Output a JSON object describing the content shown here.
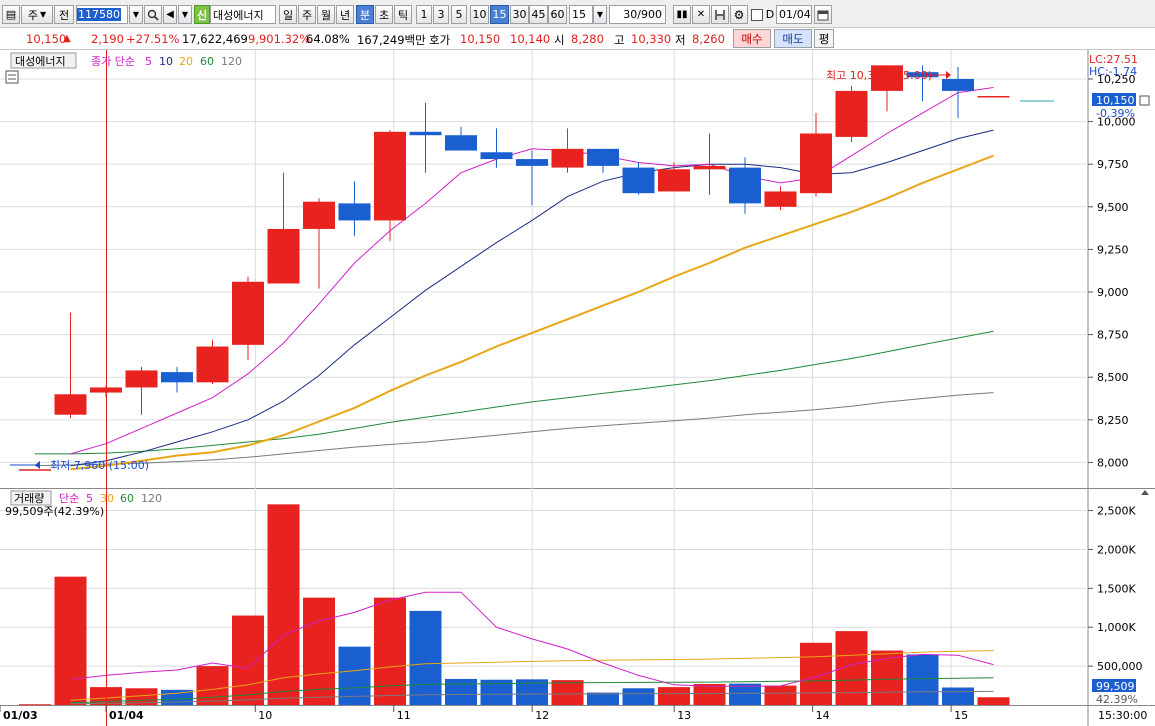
{
  "toolbar": {
    "mode_label": "주",
    "prev_label": "전",
    "stock_code": "117580",
    "credit_badge": "신",
    "stock_name": "대성에너지",
    "period_buttons": [
      "일",
      "주",
      "월",
      "년",
      "분",
      "초",
      "틱"
    ],
    "selected_period": "분",
    "interval_buttons": [
      "1",
      "3",
      "5",
      "10",
      "15",
      "30",
      "45",
      "60"
    ],
    "selected_interval": "15",
    "interval_value": "15",
    "count_value": "30/900",
    "date_checkbox_label": "D",
    "date_value": "01/04"
  },
  "quote": {
    "price": "10,150",
    "price_arrow": "▲",
    "change": "2,190",
    "change_pct": "+27.51%",
    "volume": "17,622,469",
    "volume_ratio": "9,901.32%",
    "turnover": "64.08%",
    "amount": "167,249백만",
    "ask_label": "호가",
    "ask1": "10,150",
    "ask2": "10,140",
    "open_label": "시",
    "open": "8,280",
    "high_label": "고",
    "high": "10,330",
    "low_label": "저",
    "low": "8,260",
    "buy_label": "매수",
    "sell_label": "매도",
    "avg_label": "평"
  },
  "price_panel": {
    "stock_tag": "대성에너지",
    "ma_label": "종가 단순",
    "ma_periods": [
      "5",
      "10",
      "20",
      "60",
      "120"
    ],
    "lc_text": "LC:27.51",
    "hc_text": "HC:-1.74",
    "high_marker": "최고 10,330 (15:00)",
    "low_marker": "최저 7,960 (15:00)",
    "current_price_tag": "10,150",
    "current_pct_tag": "-0.39%",
    "y_ticks": [
      "10,250",
      "10,000",
      "9,750",
      "9,500",
      "9,250",
      "9,000",
      "8,750",
      "8,500",
      "8,250",
      "8,000"
    ]
  },
  "volume_panel": {
    "label": "거래량",
    "ma_label": "단순",
    "ma_periods": [
      "5",
      "30",
      "60",
      "120"
    ],
    "current_text": "99,509주(42.39%)",
    "current_tag": "99,509",
    "pct_tag": "42.39%",
    "y_ticks": [
      "2,500K",
      "2,000K",
      "1,500K",
      "1,000K",
      "500,000"
    ]
  },
  "x_axis": {
    "labels": [
      "01/03",
      "01/04",
      "10",
      "11",
      "12",
      "13",
      "14",
      "15"
    ],
    "time_label": "15:30:00"
  },
  "colors": {
    "up": "#e8231f",
    "down": "#1a5fd0",
    "ma5": "#d020c8",
    "ma10": "#182c84",
    "ma20": "#e8a616",
    "ma60": "#1f8a3a",
    "ma120": "#7a7a7a",
    "grid": "#dcdcdc"
  },
  "chart_data": {
    "type": "candlestick",
    "title": "",
    "xlabel": "",
    "ylabel": "",
    "ylim": [
      7850,
      10420
    ],
    "volume_ylim": [
      0,
      2700000
    ],
    "candles": [
      {
        "o": 7960,
        "h": 7960,
        "l": 7960,
        "c": 7960,
        "v": 10000
      },
      {
        "o": 8280,
        "h": 8880,
        "l": 8260,
        "c": 8400,
        "v": 1650000
      },
      {
        "o": 8410,
        "h": 8450,
        "l": 8380,
        "c": 8440,
        "v": 230000
      },
      {
        "o": 8440,
        "h": 8560,
        "l": 8280,
        "c": 8540,
        "v": 215000
      },
      {
        "o": 8530,
        "h": 8560,
        "l": 8410,
        "c": 8470,
        "v": 195000
      },
      {
        "o": 8470,
        "h": 8720,
        "l": 8460,
        "c": 8680,
        "v": 500000
      },
      {
        "o": 8690,
        "h": 9090,
        "l": 8600,
        "c": 9060,
        "v": 1150000
      },
      {
        "o": 9050,
        "h": 9700,
        "l": 9050,
        "c": 9370,
        "v": 2580000
      },
      {
        "o": 9370,
        "h": 9550,
        "l": 9020,
        "c": 9530,
        "v": 1380000
      },
      {
        "o": 9520,
        "h": 9650,
        "l": 9330,
        "c": 9420,
        "v": 750000
      },
      {
        "o": 9420,
        "h": 9950,
        "l": 9300,
        "c": 9940,
        "v": 1380000
      },
      {
        "o": 9940,
        "h": 10110,
        "l": 9700,
        "c": 9920,
        "v": 1210000
      },
      {
        "o": 9920,
        "h": 9970,
        "l": 9830,
        "c": 9830,
        "v": 335000
      },
      {
        "o": 9820,
        "h": 9960,
        "l": 9730,
        "c": 9780,
        "v": 325000
      },
      {
        "o": 9780,
        "h": 9830,
        "l": 9510,
        "c": 9740,
        "v": 330000
      },
      {
        "o": 9730,
        "h": 9960,
        "l": 9700,
        "c": 9840,
        "v": 320000
      },
      {
        "o": 9840,
        "h": 9840,
        "l": 9700,
        "c": 9740,
        "v": 160000
      },
      {
        "o": 9730,
        "h": 9760,
        "l": 9570,
        "c": 9580,
        "v": 215000
      },
      {
        "o": 9590,
        "h": 9760,
        "l": 9590,
        "c": 9720,
        "v": 230000
      },
      {
        "o": 9720,
        "h": 9930,
        "l": 9570,
        "c": 9740,
        "v": 270000
      },
      {
        "o": 9730,
        "h": 9790,
        "l": 9460,
        "c": 9520,
        "v": 275000
      },
      {
        "o": 9500,
        "h": 9620,
        "l": 9480,
        "c": 9590,
        "v": 250000
      },
      {
        "o": 9580,
        "h": 10050,
        "l": 9560,
        "c": 9930,
        "v": 800000
      },
      {
        "o": 9910,
        "h": 10210,
        "l": 9880,
        "c": 10180,
        "v": 950000
      },
      {
        "o": 10180,
        "h": 10330,
        "l": 10060,
        "c": 10330,
        "v": 700000
      },
      {
        "o": 10290,
        "h": 10330,
        "l": 10120,
        "c": 10260,
        "v": 650000
      },
      {
        "o": 10250,
        "h": 10320,
        "l": 10020,
        "c": 10180,
        "v": 225000
      },
      {
        "o": 10150,
        "h": 10150,
        "l": 10150,
        "c": 10150,
        "v": 99509
      }
    ],
    "ma5": [
      null,
      8050,
      8110,
      8200,
      8290,
      8380,
      8520,
      8700,
      8930,
      9170,
      9360,
      9520,
      9700,
      9780,
      9840,
      9830,
      9800,
      9760,
      9740,
      9750,
      9680,
      9640,
      9670,
      9800,
      9930,
      10050,
      10170,
      10200
    ],
    "ma10": [
      null,
      7980,
      8010,
      8060,
      8120,
      8180,
      8250,
      8360,
      8510,
      8690,
      8850,
      9010,
      9150,
      9290,
      9420,
      9560,
      9650,
      9700,
      9730,
      9750,
      9750,
      9730,
      9690,
      9700,
      9760,
      9830,
      9900,
      9950
    ],
    "ma20": [
      null,
      7960,
      7980,
      8010,
      8040,
      8060,
      8100,
      8160,
      8240,
      8320,
      8420,
      8510,
      8590,
      8680,
      8760,
      8840,
      8920,
      9000,
      9090,
      9170,
      9260,
      9330,
      9400,
      9470,
      9550,
      9640,
      9720,
      9800
    ],
    "ma60": [
      8050,
      8050,
      8055,
      8065,
      8080,
      8100,
      8120,
      8140,
      8165,
      8200,
      8235,
      8265,
      8295,
      8325,
      8355,
      8380,
      8405,
      8430,
      8455,
      8480,
      8510,
      8540,
      8575,
      8610,
      8650,
      8690,
      8730,
      8770
    ],
    "ma120": [
      7980,
      7985,
      7990,
      7995,
      8005,
      8015,
      8030,
      8050,
      8070,
      8090,
      8105,
      8120,
      8140,
      8160,
      8180,
      8200,
      8215,
      8230,
      8245,
      8260,
      8280,
      8295,
      8310,
      8330,
      8355,
      8375,
      8395,
      8410
    ],
    "vol_ma5": [
      null,
      330000,
      380000,
      420000,
      450000,
      540000,
      470000,
      900000,
      1080000,
      1190000,
      1350000,
      1450000,
      1450000,
      1000000,
      850000,
      720000,
      540000,
      380000,
      260000,
      240000,
      240000,
      245000,
      360000,
      520000,
      600000,
      650000,
      640000,
      520000
    ],
    "vol_ma30": [
      null,
      60000,
      90000,
      120000,
      150000,
      200000,
      260000,
      350000,
      400000,
      440000,
      490000,
      530000,
      540000,
      550000,
      560000,
      570000,
      575000,
      580000,
      585000,
      590000,
      600000,
      610000,
      620000,
      640000,
      660000,
      680000,
      690000,
      700000
    ],
    "vol_ma60": [
      null,
      30000,
      45000,
      60000,
      75000,
      100000,
      130000,
      175000,
      200000,
      220000,
      245000,
      265000,
      270000,
      275000,
      280000,
      285000,
      288000,
      290000,
      292000,
      295000,
      300000,
      305000,
      310000,
      320000,
      330000,
      340000,
      345000,
      350000
    ],
    "vol_ma120": [
      null,
      15000,
      22000,
      30000,
      38000,
      50000,
      65000,
      88000,
      100000,
      110000,
      122000,
      132000,
      135000,
      138000,
      140000,
      142000,
      144000,
      145000,
      146000,
      148000,
      150000,
      152000,
      155000,
      160000,
      165000,
      170000,
      172000,
      175000
    ]
  }
}
